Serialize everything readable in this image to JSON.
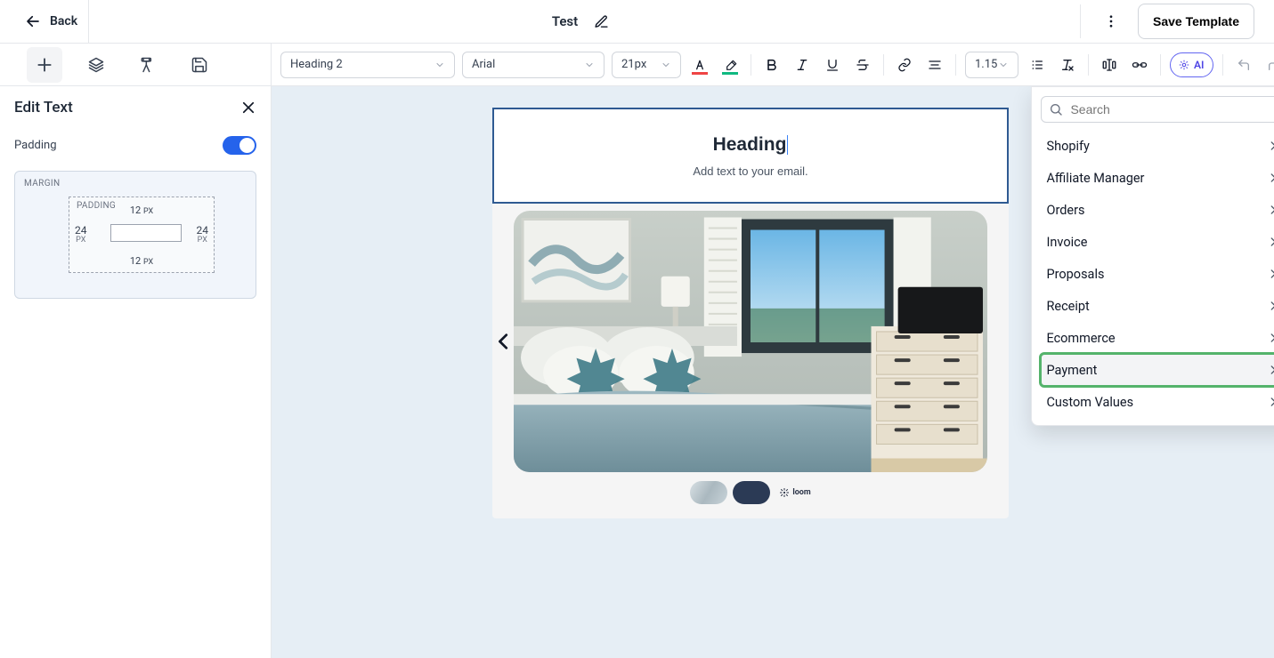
{
  "header": {
    "back_label": "Back",
    "title": "Test",
    "save_label": "Save Template"
  },
  "sidebar": {
    "panel_title": "Edit Text",
    "padding_label": "Padding",
    "padding_on": true,
    "box": {
      "margin_label": "MARGIN",
      "inner_label": "PADDING",
      "top": "12",
      "top_unit": "PX",
      "bottom": "12",
      "bottom_unit": "PX",
      "left": "24",
      "left_unit": "PX",
      "right": "24",
      "right_unit": "PX"
    }
  },
  "toolbar": {
    "style": "Heading 2",
    "font": "Arial",
    "size": "21px",
    "line_height": "1.15",
    "ai_label": "AI"
  },
  "canvas": {
    "heading": "Heading",
    "subtext": "Add text to your email.",
    "loom_label": "loom"
  },
  "dropdown": {
    "search_placeholder": "Search",
    "items": [
      {
        "label": "Shopify"
      },
      {
        "label": "Affiliate Manager"
      },
      {
        "label": "Orders"
      },
      {
        "label": "Invoice"
      },
      {
        "label": "Proposals"
      },
      {
        "label": "Receipt"
      },
      {
        "label": "Ecommerce"
      },
      {
        "label": "Payment",
        "highlighted": true
      },
      {
        "label": "Custom Values"
      }
    ]
  }
}
